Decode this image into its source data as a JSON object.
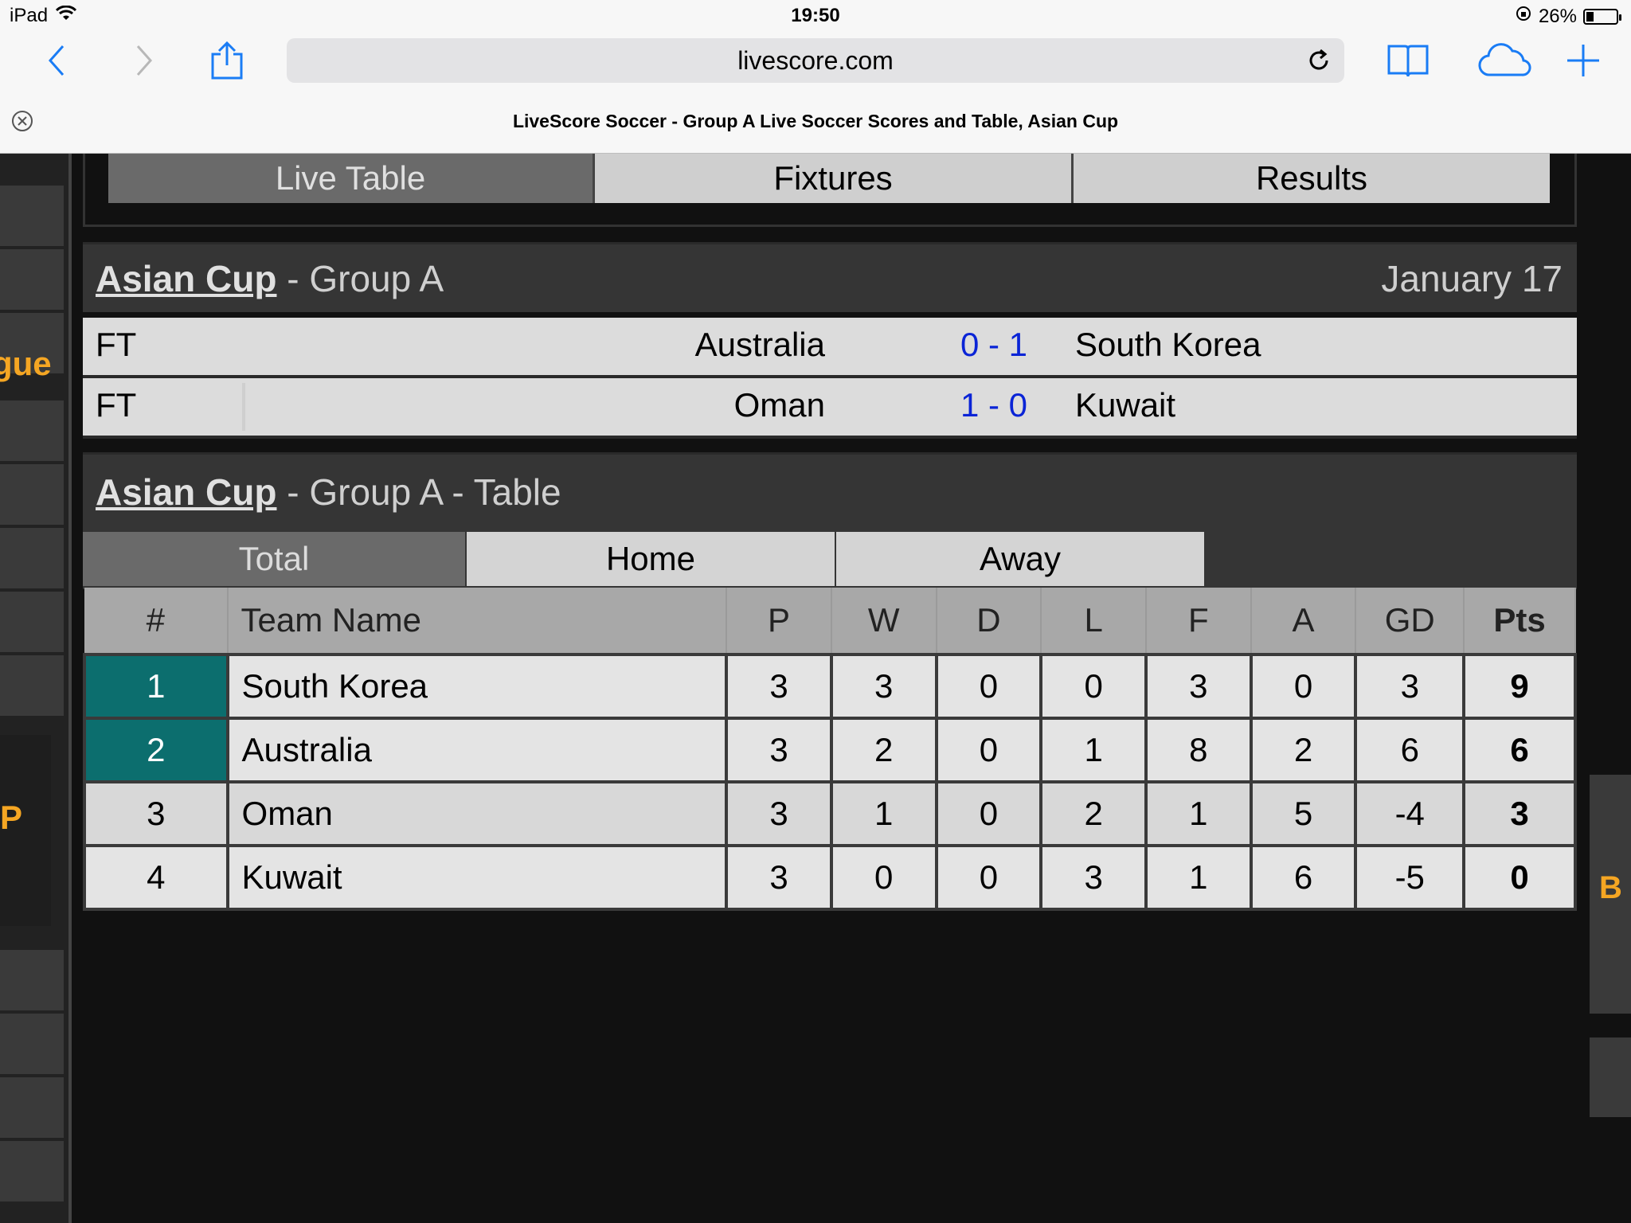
{
  "status_bar": {
    "device": "iPad",
    "time": "19:50",
    "battery": "26%",
    "battery_level": 0.26
  },
  "browser": {
    "url": "livescore.com",
    "tab_title": "LiveScore Soccer - Group A Live Soccer Scores and Table, Asian Cup"
  },
  "top_tabs": [
    "Live Table",
    "Fixtures",
    "Results"
  ],
  "side_labels": {
    "left_league": "gue",
    "left_ad": "P",
    "right_ad": "B"
  },
  "fixtures_section": {
    "competition": "Asian Cup",
    "group": " - Group A",
    "date": "January 17",
    "matches": [
      {
        "status": "FT",
        "home": "Australia",
        "score": "0 - 1",
        "away": "South Korea"
      },
      {
        "status": "FT",
        "home": "Oman",
        "score": "1 - 0",
        "away": "Kuwait"
      }
    ]
  },
  "table_section": {
    "competition": "Asian Cup",
    "subtitle": " - Group A - Table",
    "subtabs": [
      "Total",
      "Home",
      "Away"
    ],
    "headers": [
      "#",
      "Team Name",
      "P",
      "W",
      "D",
      "L",
      "F",
      "A",
      "GD",
      "Pts"
    ],
    "rows": [
      {
        "pos": "1",
        "team": "South Korea",
        "p": "3",
        "w": "3",
        "d": "0",
        "l": "0",
        "f": "3",
        "a": "0",
        "gd": "3",
        "pts": "9"
      },
      {
        "pos": "2",
        "team": "Australia",
        "p": "3",
        "w": "2",
        "d": "0",
        "l": "1",
        "f": "8",
        "a": "2",
        "gd": "6",
        "pts": "6"
      },
      {
        "pos": "3",
        "team": "Oman",
        "p": "3",
        "w": "1",
        "d": "0",
        "l": "2",
        "f": "1",
        "a": "5",
        "gd": "-4",
        "pts": "3"
      },
      {
        "pos": "4",
        "team": "Kuwait",
        "p": "3",
        "w": "0",
        "d": "0",
        "l": "3",
        "f": "1",
        "a": "6",
        "gd": "-5",
        "pts": "0"
      }
    ]
  },
  "colors": {
    "qualified": "#0c6e6e",
    "score": "#0a24d6",
    "ios_blue": "#1a7cf5",
    "accent_orange": "#f5a623"
  }
}
